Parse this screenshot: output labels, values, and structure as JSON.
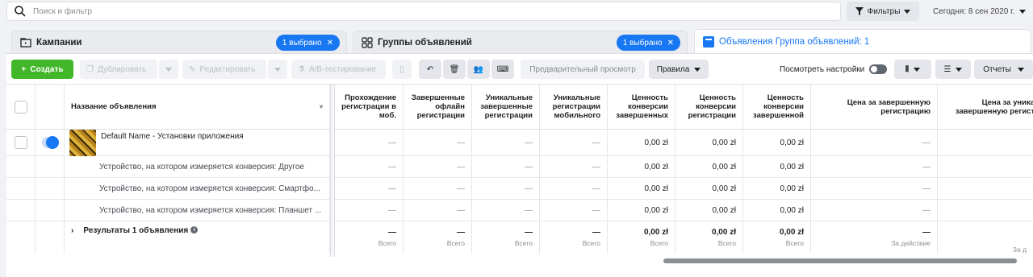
{
  "search": {
    "placeholder": "Поиск и фильтр"
  },
  "filters_label": "Фильтры",
  "date_label": "Сегодня: 8 сен 2020 г.",
  "tabs": [
    {
      "label": "Кампании",
      "selected_pill": "1 выбрано"
    },
    {
      "label": "Группы объявлений",
      "selected_pill": "1 выбрано"
    },
    {
      "label": "Объявления Группа объявлений: 1"
    }
  ],
  "toolbar": {
    "create": "Создать",
    "duplicate": "Дублировать",
    "edit": "Редактировать",
    "ab_test": "A/B-тестирование",
    "preview": "Предварительный просмотр",
    "rules": "Правила",
    "view_settings": "Посмотреть настройки",
    "reports": "Отчеты"
  },
  "columns": [
    "Название объявления",
    "Прохождение регистрации в моб.",
    "Завершенные офлайн регистрации",
    "Уникальные завершенные регистрации",
    "Уникальные регистрации мобильного",
    "Ценность конверсии завершенных",
    "Ценность конверсии регистрации",
    "Ценность конверсии завершенной",
    "Цена за завершенную регистрацию",
    "Цена за уникальную завершенную регистрацию"
  ],
  "rows": [
    {
      "name": "Default Name - Установки приложения",
      "values": [
        "—",
        "—",
        "—",
        "—",
        "0,00 zł",
        "0,00 zł",
        "0,00 zł",
        "—"
      ]
    },
    {
      "name": "Устройство, на котором измеряется конверсия: Другое",
      "values": [
        "—",
        "—",
        "—",
        "—",
        "0,00 zł",
        "0,00 zł",
        "0,00 zł",
        "—"
      ]
    },
    {
      "name": "Устройство, на котором измеряется конверсия: Смартфо...",
      "values": [
        "—",
        "—",
        "—",
        "—",
        "0,00 zł",
        "0,00 zł",
        "0,00 zł",
        "—"
      ]
    },
    {
      "name": "Устройство, на котором измеряется конверсия: Планшет ...",
      "values": [
        "—",
        "—",
        "—",
        "—",
        "0,00 zł",
        "0,00 zł",
        "0,00 zł",
        "—"
      ]
    }
  ],
  "totals": {
    "label": "Результаты 1 объявления",
    "values": [
      "—",
      "—",
      "—",
      "—",
      "0,00 zł",
      "0,00 zł",
      "0,00 zł",
      "—"
    ],
    "subs": [
      "Всего",
      "Всего",
      "Всего",
      "Всего",
      "Всего",
      "Всего",
      "Всего",
      "За действие",
      "За д"
    ]
  },
  "colors": {
    "accent": "#1877f2",
    "create": "#42b72a"
  }
}
